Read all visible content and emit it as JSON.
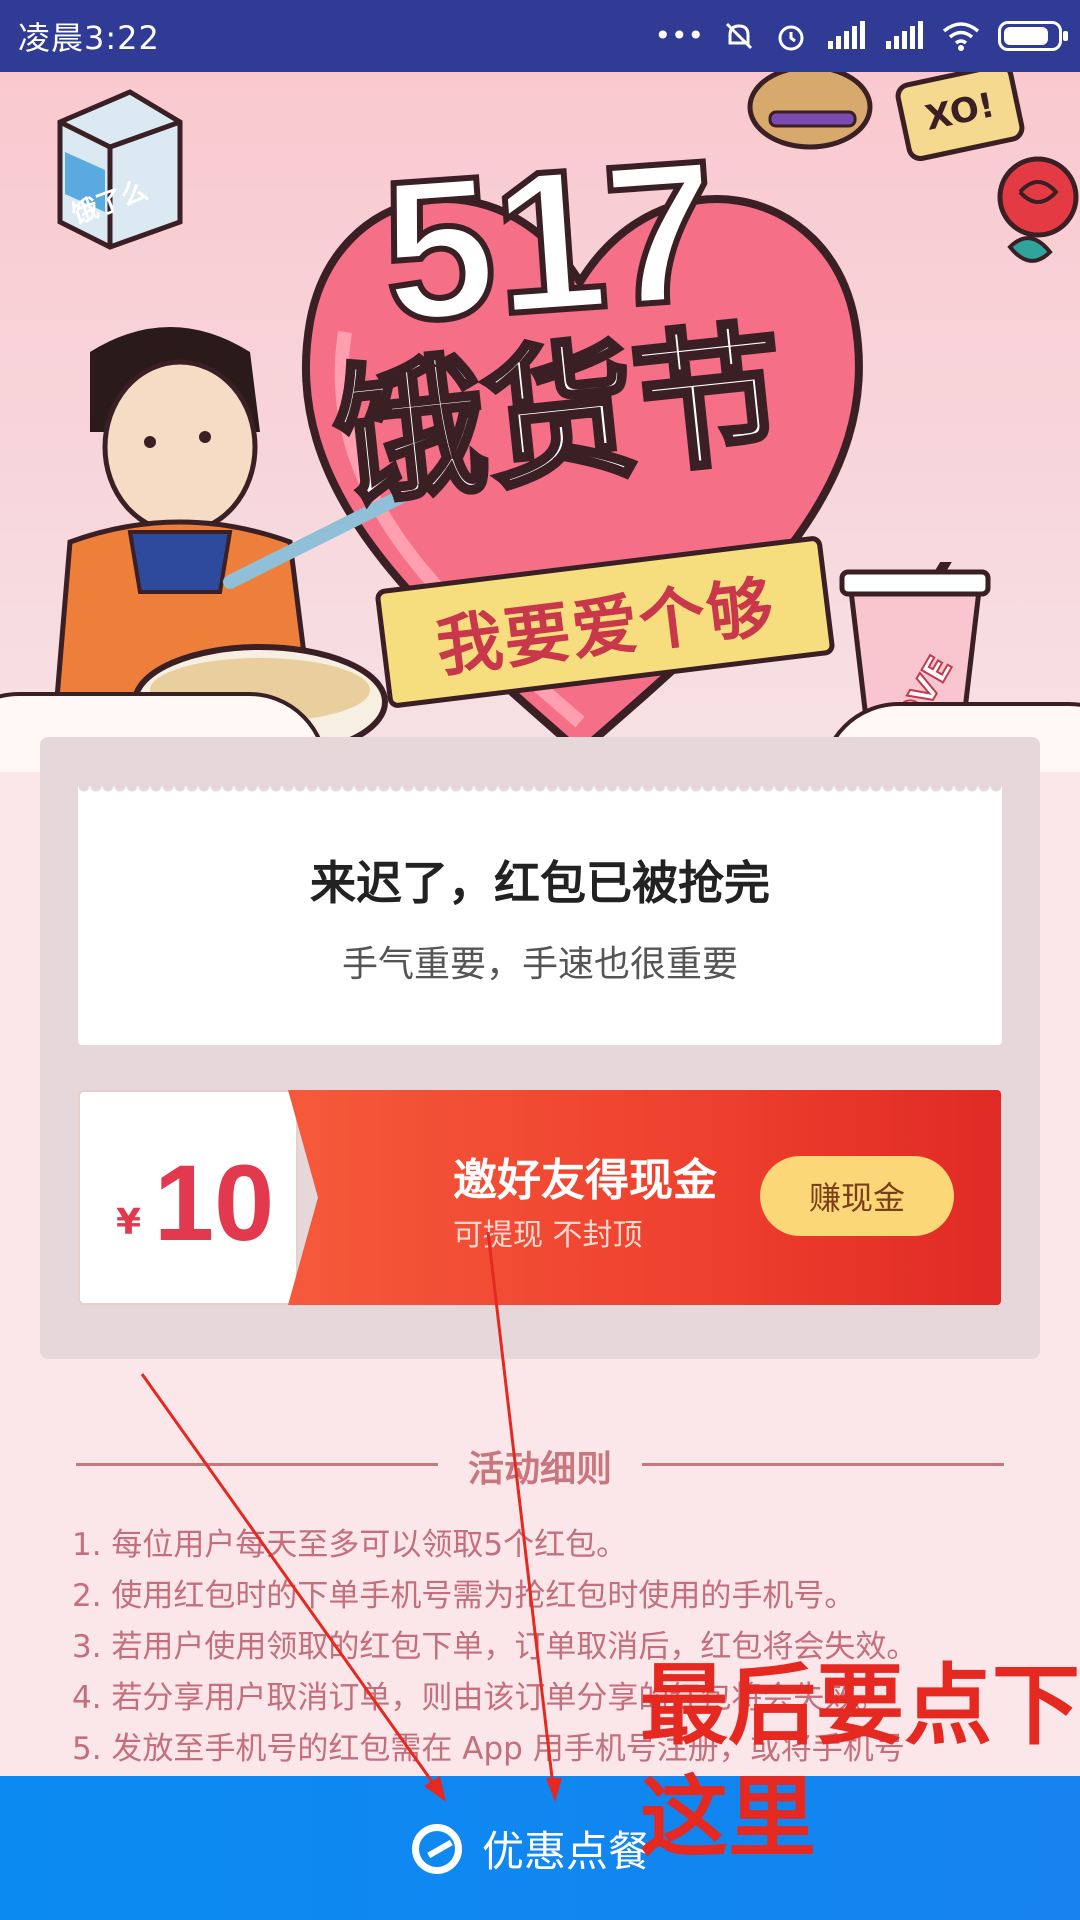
{
  "status_bar": {
    "time": "凌晨3:22",
    "icons": [
      "more-dots-icon",
      "mute-icon",
      "alarm-icon",
      "signal-icon",
      "signal-icon",
      "wifi-icon",
      "battery-icon"
    ]
  },
  "banner": {
    "title_number": "517",
    "title_text": "饿货节",
    "ribbon_text": "我要爱个够",
    "box_text": "饿了么",
    "cup_text": "LOVE",
    "cookie_text": "XO!"
  },
  "result": {
    "title": "来迟了，红包已被抢完",
    "subtitle": "手气重要，手速也很重要"
  },
  "coupon": {
    "currency": "¥",
    "amount": "10",
    "title": "邀好友得现金",
    "description": "可提现 不封顶",
    "button_label": "赚现金"
  },
  "rules": {
    "title": "活动细则",
    "items": [
      "1. 每位用户每天至多可以领取5个红包。",
      "2. 使用红包时的下单手机号需为抢红包时使用的手机号。",
      "3. 若用户使用领取的红包下单，订单取消后，红包将会失效。",
      "4. 若分享用户取消订单，则由该订单分享的红包将会失效。",
      "5. 发放至手机号的红包需在 App 用手机号注册，或将手机号"
    ]
  },
  "bottom_bar": {
    "label": "优惠点餐"
  },
  "annotation": {
    "line1": "最后要点下",
    "line2": "这里",
    "color": "#e52820"
  }
}
